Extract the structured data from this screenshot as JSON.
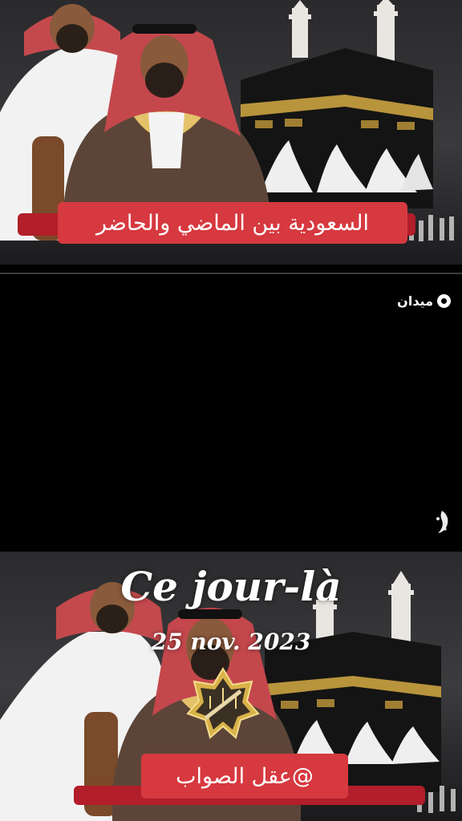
{
  "top_video": {
    "caption": "السعودية بين الماضي والحاضر"
  },
  "middle_video": {
    "brand": "ميدان",
    "brand_icon": "midan-logo-icon",
    "corner_icon": "aljazeera-logo-icon"
  },
  "bottom_video": {
    "title": "Ce jour-là",
    "date": "25 nov. 2023",
    "caption": "@عقل الصواب",
    "emblem_icon": "gold-emblem-icon"
  },
  "colors": {
    "caption_red": "#d6393f",
    "caption_bar": "#b21e2a",
    "kaaba_gold": "#b8943c"
  }
}
